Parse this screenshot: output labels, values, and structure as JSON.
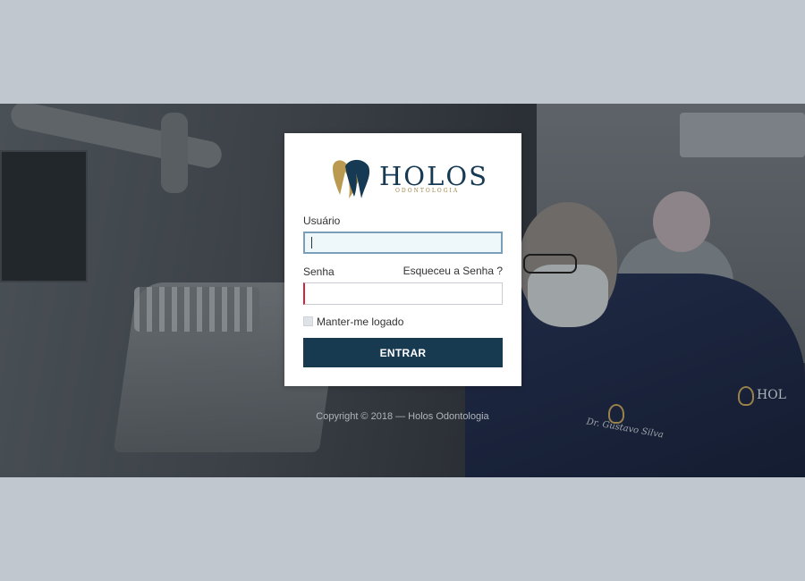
{
  "brand": {
    "name": "HOLOS",
    "subtitle": "ODONTOLOGIA",
    "primary_color": "#173a51",
    "accent_color": "#b99a50"
  },
  "background": {
    "description_icon": "dental-clinic-photo",
    "embroidery_text": "Dr. Gustavo Silva",
    "badge_text": "HOL"
  },
  "login": {
    "username_label": "Usuário",
    "username_value": "",
    "password_label": "Senha",
    "password_value": "",
    "forgot_label": "Esqueceu a Senha ?",
    "remember_label": "Manter-me logado",
    "remember_checked": false,
    "submit_label": "ENTRAR"
  },
  "footer": {
    "copyright": "Copyright © 2018 — Holos Odontologia"
  }
}
